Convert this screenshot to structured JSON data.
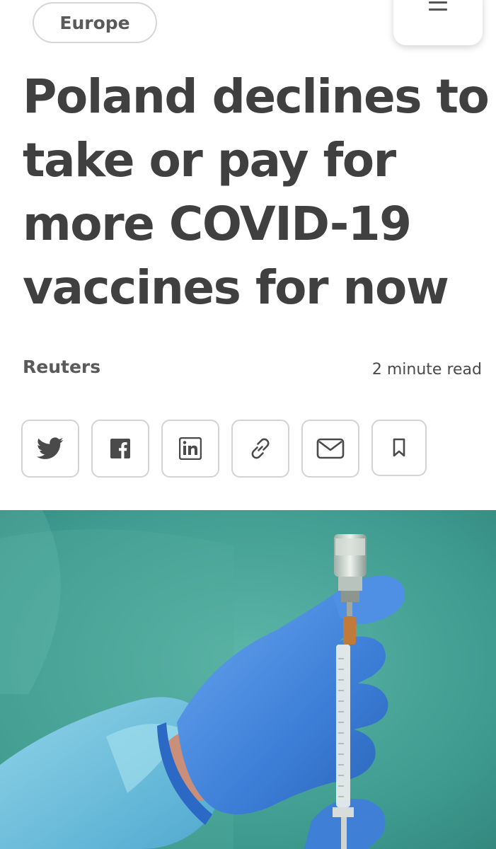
{
  "header": {
    "category": "Europe",
    "menu_icon": "hamburger-menu-icon"
  },
  "article": {
    "headline": "Poland declines to take or pay for more COVID-19 vaccines for now",
    "byline": "Reuters",
    "read_time": "2 minute read"
  },
  "share": {
    "buttons": [
      {
        "name": "twitter",
        "icon": "twitter-icon"
      },
      {
        "name": "facebook",
        "icon": "facebook-icon"
      },
      {
        "name": "linkedin",
        "icon": "linkedin-icon"
      },
      {
        "name": "copy-link",
        "icon": "link-icon"
      },
      {
        "name": "email",
        "icon": "envelope-icon"
      },
      {
        "name": "bookmark",
        "icon": "bookmark-icon"
      }
    ]
  },
  "hero_image": {
    "subject": "gloved hand holding syringe and vaccine vial"
  },
  "colors": {
    "text": "#404040",
    "border": "#d3d3d3",
    "glove": "#4d8fe0",
    "background_teal": "#4aa89a"
  }
}
